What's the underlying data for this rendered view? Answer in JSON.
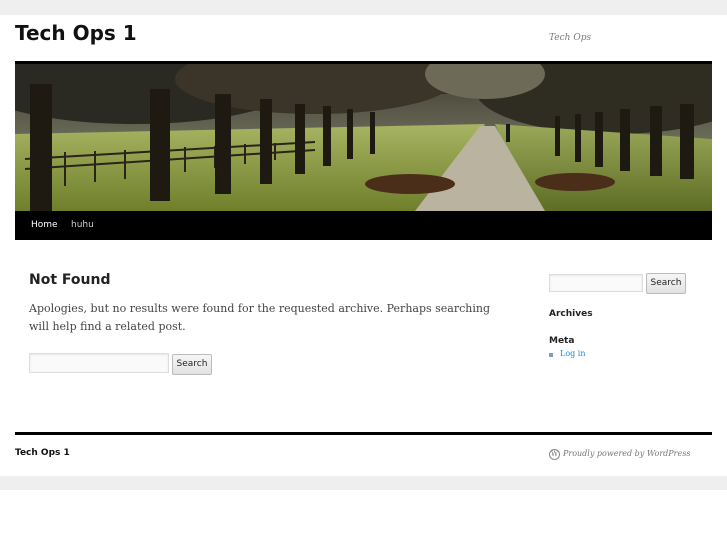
{
  "site": {
    "title": "Tech Ops 1",
    "description": "Tech Ops"
  },
  "nav": {
    "items": [
      {
        "label": "Home"
      },
      {
        "label": "huhu"
      }
    ]
  },
  "main": {
    "heading": "Not Found",
    "message": "Apologies, but no results were found for the requested archive. Perhaps searching will help find a related post.",
    "search": {
      "value": "",
      "placeholder": "",
      "button_label": "Search"
    }
  },
  "sidebar": {
    "search": {
      "value": "",
      "placeholder": "",
      "button_label": "Search"
    },
    "archives_title": "Archives",
    "meta_title": "Meta",
    "meta_links": [
      {
        "label": "Log in"
      }
    ]
  },
  "footer": {
    "site_title": "Tech Ops 1",
    "powered_by": "Proudly powered by WordPress",
    "wp_icon": "wordpress-icon"
  },
  "colors": {
    "link": "#1b8be0",
    "header_rule": "#000000",
    "page_bg": "#efefef"
  }
}
